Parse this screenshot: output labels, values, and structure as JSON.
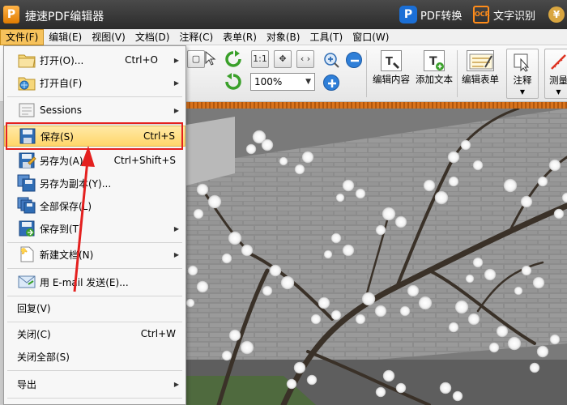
{
  "titlebar": {
    "logo": "P",
    "title": "捷速PDF编辑器",
    "pdf_convert_icon": "P",
    "pdf_convert_label": "PDF转换",
    "ocr_icon": "OCR",
    "ocr_label": "文字识别",
    "currency_icon": "¥"
  },
  "menubar": {
    "items": [
      "文件(F)",
      "编辑(E)",
      "视图(V)",
      "文档(D)",
      "注释(C)",
      "表单(R)",
      "对象(B)",
      "工具(T)",
      "窗口(W)"
    ]
  },
  "toolbar": {
    "zoom_value": "100%",
    "fit_page_label": "1:1",
    "edit_content": "编辑内容",
    "add_text": "添加文本",
    "edit_form": "编辑表单",
    "annotate": "注释",
    "measure": "测量"
  },
  "file_menu": {
    "items": [
      {
        "label": "打开(O)...",
        "shortcut": "Ctrl+O",
        "submenu": true
      },
      {
        "label": "打开自(F)",
        "shortcut": "",
        "submenu": true
      },
      {
        "label": "Sessions",
        "shortcut": "",
        "submenu": true
      },
      {
        "label": "保存(S)",
        "shortcut": "Ctrl+S",
        "submenu": false
      },
      {
        "label": "另存为(A)...",
        "shortcut": "Ctrl+Shift+S",
        "submenu": false
      },
      {
        "label": "另存为副本(Y)...",
        "shortcut": "",
        "submenu": false
      },
      {
        "label": "全部保存(L)",
        "shortcut": "",
        "submenu": false
      },
      {
        "label": "保存到(T)",
        "shortcut": "",
        "submenu": true
      },
      {
        "label": "新建文档(N)",
        "shortcut": "",
        "submenu": true
      },
      {
        "label": "用 E-mail 发送(E)...",
        "shortcut": "",
        "submenu": false
      },
      {
        "label": "回复(V)",
        "shortcut": "",
        "submenu": false
      },
      {
        "label": "关闭(C)",
        "shortcut": "Ctrl+W",
        "submenu": false
      },
      {
        "label": "关闭全部(S)",
        "shortcut": "",
        "submenu": false
      },
      {
        "label": "导出",
        "shortcut": "",
        "submenu": true
      }
    ]
  },
  "colors": {
    "highlight": "#ffd66a",
    "annotation_red": "#e4201f",
    "titlebar": "#2b2b2b",
    "accent_orange": "#e07b00"
  }
}
